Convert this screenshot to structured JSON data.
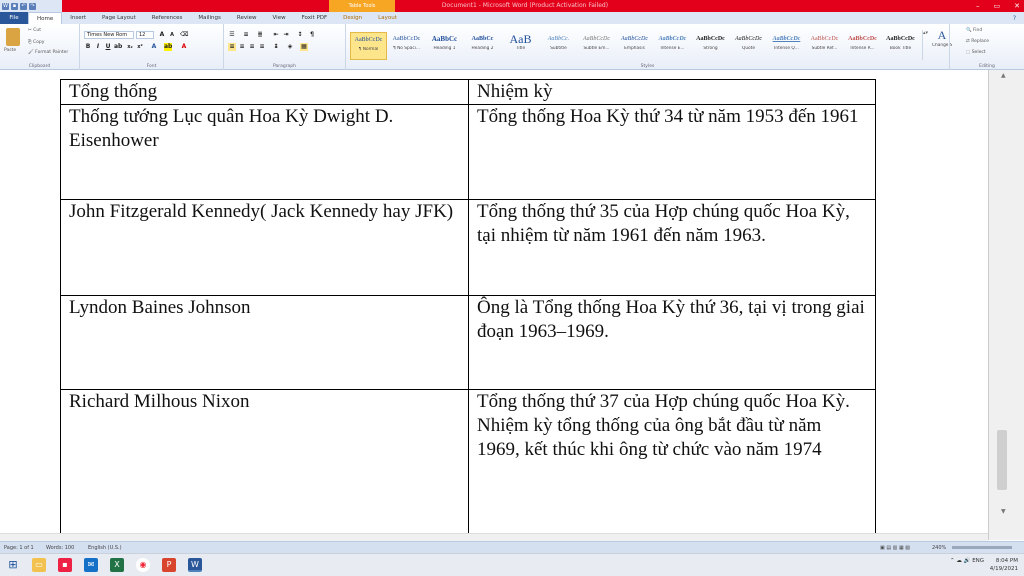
{
  "window": {
    "title": "Document1 - Microsoft Word (Product Activation Failed)",
    "context_tab": "Table Tools"
  },
  "ribbon_tabs": [
    "File",
    "Home",
    "Insert",
    "Page Layout",
    "References",
    "Mailings",
    "Review",
    "View",
    "Foxit PDF",
    "Design",
    "Layout"
  ],
  "clipboard": {
    "paste": "Paste",
    "cut": "Cut",
    "copy": "Copy",
    "format_painter": "Format Painter",
    "label": "Clipboard"
  },
  "font": {
    "name": "Times New Rom",
    "size": "12",
    "label": "Font"
  },
  "paragraph": {
    "label": "Paragraph"
  },
  "styles": {
    "label": "Styles",
    "items": [
      {
        "sample": "AaBbCcDc",
        "name": "¶ Normal"
      },
      {
        "sample": "AaBbCcDc",
        "name": "¶ No Spaci..."
      },
      {
        "sample": "AaBbCc",
        "name": "Heading 1"
      },
      {
        "sample": "AaBbCc",
        "name": "Heading 2"
      },
      {
        "sample": "AaB",
        "name": "Title"
      },
      {
        "sample": "AaBbCc.",
        "name": "Subtitle"
      },
      {
        "sample": "AaBbCcDc",
        "name": "Subtle Em..."
      },
      {
        "sample": "AaBbCcDc",
        "name": "Emphasis"
      },
      {
        "sample": "AaBbCcDc",
        "name": "Intense E..."
      },
      {
        "sample": "AaBbCcDc",
        "name": "Strong"
      },
      {
        "sample": "AaBbCcDc",
        "name": "Quote"
      },
      {
        "sample": "AaBbCcDc",
        "name": "Intense Q..."
      },
      {
        "sample": "AaBbCcDc",
        "name": "Subtle Ref..."
      },
      {
        "sample": "AaBbCcDc",
        "name": "Intense R..."
      },
      {
        "sample": "AaBbCcDc",
        "name": "Book Title"
      }
    ],
    "change_styles": "Change Styles"
  },
  "editing": {
    "find": "Find",
    "replace": "Replace",
    "select": "Select",
    "label": "Editing"
  },
  "table": {
    "rows": [
      [
        "Tổng thống",
        "Nhiệm kỳ"
      ],
      [
        "Thống tướng Lục quân Hoa Kỳ Dwight D. Eisenhower",
        "Tổng thống Hoa Kỳ thứ 34 từ năm 1953 đến 1961"
      ],
      [
        "John Fitzgerald Kennedy( Jack Kennedy hay JFK)",
        "Tổng thống thứ 35 của Hợp chúng quốc Hoa Kỳ, tại nhiệm từ năm 1961 đến năm 1963."
      ],
      [
        "Lyndon Baines Johnson",
        "Ông là Tổng thống Hoa Kỳ thứ 36, tại vị trong giai đoạn 1963–1969."
      ],
      [
        "Richard Milhous Nixon",
        "Tổng thống thứ 37 của Hợp chúng quốc Hoa Kỳ. Nhiệm kỳ tổng thống của ông bắt đầu từ năm 1969, kết thúc khi ông từ chức vào năm 1974"
      ]
    ]
  },
  "status": {
    "page": "Page: 1 of 1",
    "words": "Words: 100",
    "language": "English (U.S.)",
    "zoom": "240%"
  },
  "tray": {
    "lang": "ENG",
    "time": "8:04 PM",
    "date": "4/19/2021"
  }
}
